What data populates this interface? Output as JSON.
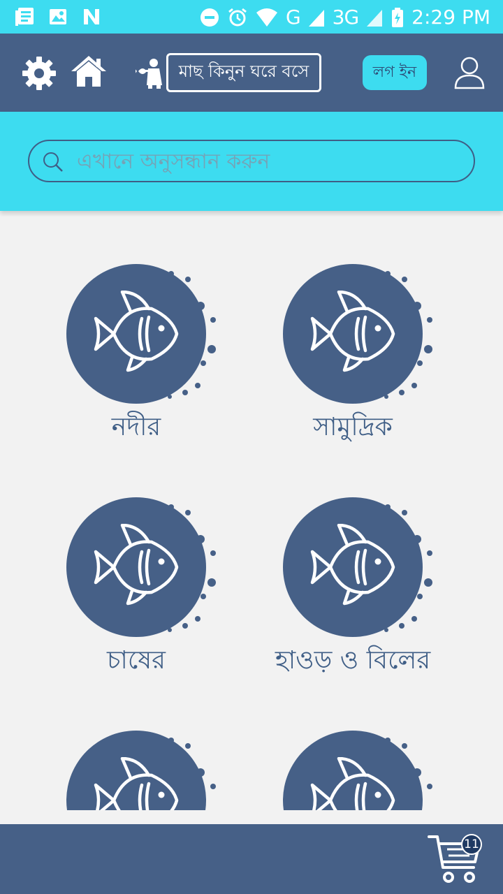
{
  "status_bar": {
    "time": "2:29 PM",
    "network": "G",
    "network_3g": "3G",
    "icons": [
      "news-icon",
      "image-icon",
      "n-app-icon",
      "dnd-icon",
      "alarm-icon",
      "wifi-icon",
      "signal-icon",
      "battery-icon"
    ]
  },
  "header": {
    "tagline": "মাছ কিনুন ঘরে বসে",
    "login_label": "লগ ইন",
    "icons": [
      "gear-icon",
      "home-icon",
      "mascot-logo",
      "user-icon"
    ]
  },
  "search": {
    "placeholder": "এখানে অনুসন্ধান করুন"
  },
  "categories": [
    {
      "label": "নদীর",
      "icon": "fish-icon"
    },
    {
      "label": "সামুদ্রিক",
      "icon": "fish-icon"
    },
    {
      "label": "চাষের",
      "icon": "fish-icon"
    },
    {
      "label": "হাওড় ও বিলের",
      "icon": "fish-icon"
    },
    {
      "label": "",
      "icon": "fish-icon"
    },
    {
      "label": "",
      "icon": "fish-icon"
    }
  ],
  "cart": {
    "count": "11",
    "icon": "cart-icon"
  },
  "colors": {
    "primary": "#466087",
    "accent": "#3ddcf0",
    "background": "#f2f2f2",
    "text": "#3f5e86"
  }
}
